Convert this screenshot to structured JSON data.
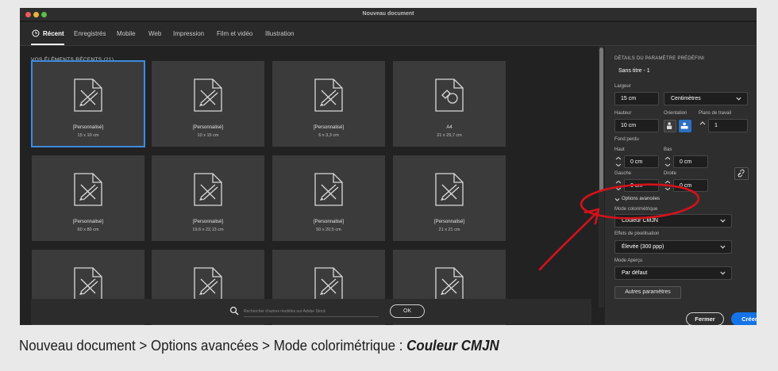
{
  "window": {
    "title": "Nouveau document"
  },
  "tabs": [
    {
      "label": "Récent",
      "active": true
    },
    {
      "label": "Enregistrés"
    },
    {
      "label": "Mobile"
    },
    {
      "label": "Web"
    },
    {
      "label": "Impression"
    },
    {
      "label": "Film et vidéo"
    },
    {
      "label": "Illustration"
    }
  ],
  "recent": {
    "title": "VOS ÉLÉMENTS RÉCENTS  (21)",
    "items": [
      {
        "name": "[Personnalisé]",
        "size": "15 x 10 cm",
        "icon": "custom-document-icon",
        "selected": true
      },
      {
        "name": "[Personnalisé]",
        "size": "10 x 15 cm",
        "icon": "custom-document-icon"
      },
      {
        "name": "[Personnalisé]",
        "size": "6 x 3,3 cm",
        "icon": "custom-document-icon"
      },
      {
        "name": "A4",
        "size": "21 x 29,7 cm",
        "icon": "print-document-icon"
      },
      {
        "name": "[Personnalisé]",
        "size": "60 x 80 cm",
        "icon": "custom-document-icon"
      },
      {
        "name": "[Personnalisé]",
        "size": "19,6 x 22,13 cm",
        "icon": "custom-document-icon"
      },
      {
        "name": "[Personnalisé]",
        "size": "50 x 20,5 cm",
        "icon": "custom-document-icon"
      },
      {
        "name": "[Personnalisé]",
        "size": "21 x 21 cm",
        "icon": "custom-document-icon"
      },
      {
        "name": "",
        "size": "",
        "icon": "custom-document-icon"
      },
      {
        "name": "",
        "size": "",
        "icon": "custom-document-icon"
      },
      {
        "name": "",
        "size": "",
        "icon": "custom-document-icon"
      },
      {
        "name": "",
        "size": "",
        "icon": "custom-document-icon"
      }
    ]
  },
  "search": {
    "placeholder": "Rechercher d'autres modèles sur Adobe Stock",
    "ok_label": "OK"
  },
  "panel": {
    "heading": "DÉTAILS DU PARAMÈTRE PRÉDÉFINI",
    "doc_name": "Sans titre - 1",
    "width_label": "Largeur",
    "width_value": "15 cm",
    "unit_value": "Centimètres",
    "height_label": "Hauteur",
    "height_value": "10 cm",
    "orientation_label": "Orientation",
    "artboards_label": "Plans de travail",
    "artboards_value": "1",
    "bleed_label": "Fond perdu",
    "top_label": "Haut",
    "top_value": "0 cm",
    "bottom_label": "Bas",
    "bottom_value": "0 cm",
    "left_label": "Gauche",
    "left_value": "0 cm",
    "right_label": "Droite",
    "right_value": "0 cm",
    "advanced_label": "Options avancées",
    "color_mode_label": "Mode colorimétrique",
    "color_mode_value": "Couleur CMJN",
    "raster_label": "Effets de pixellisation",
    "raster_value": "Élevée (300 ppp)",
    "preview_label": "Mode Aperçu",
    "preview_value": "Par défaut",
    "more_settings_label": "Autres paramètres",
    "close_label": "Fermer",
    "create_label": "Créer"
  },
  "colors": {
    "accent": "#1473e6",
    "annotation": "#d4121b",
    "selection": "#3c8be3"
  },
  "caption": {
    "prefix": "Nouveau document > Options avancées > Mode colorimétrique : ",
    "emphasis": "Couleur CMJN"
  }
}
